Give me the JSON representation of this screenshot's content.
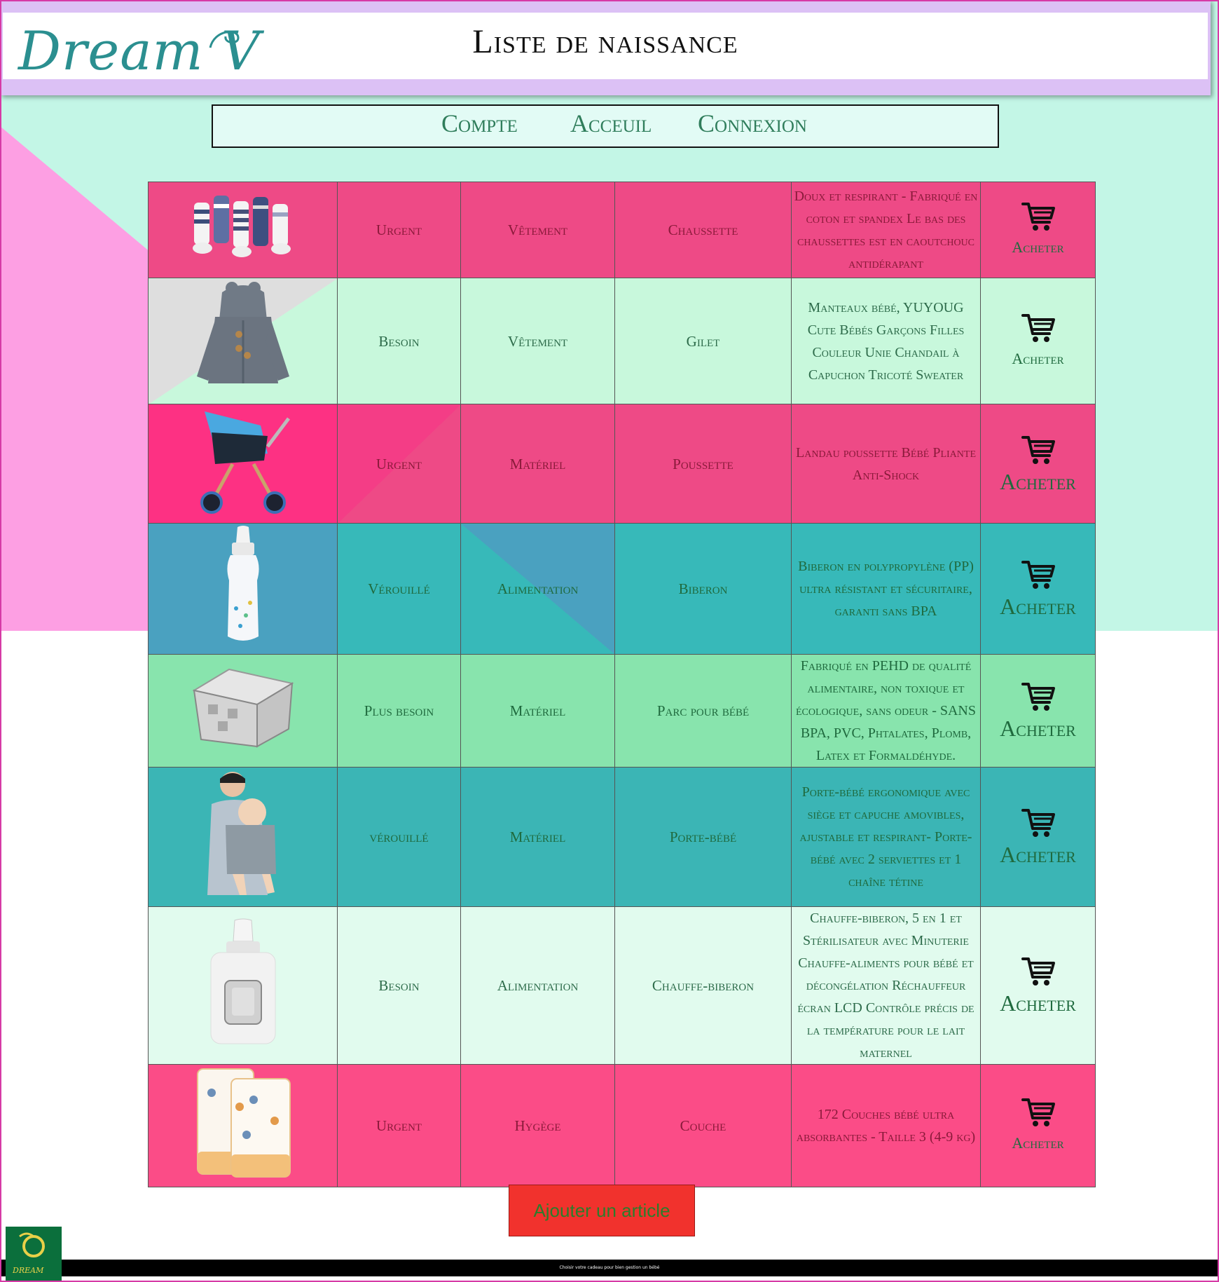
{
  "header": {
    "logo": "Dream V",
    "title": "Liste de naissance"
  },
  "nav": {
    "items": [
      "Compte",
      "Acceuil",
      "Connexion"
    ]
  },
  "rows": [
    {
      "status": "Urgent",
      "category": "Vêtement",
      "name": "Chaussette",
      "description": "Doux et respirant  - Fabriqué en coton et spandex Le bas des chaussettes est en caoutchouc antidérapant",
      "buy": "Acheter",
      "image": "socks"
    },
    {
      "status": "Besoin",
      "category": "Vêtement",
      "name": "Gilet",
      "description": "Manteaux bébé, YUYOUG Cute Bébés Garçons Filles Couleur Unie Chandail à Capuchon Tricoté Sweater",
      "buy": "Acheter",
      "image": "hooded-cardigan"
    },
    {
      "status": "Urgent",
      "category": "Matériel",
      "name": "Poussette",
      "description": "Landau poussette Bébé Pliante Anti-Shock",
      "buy": "Acheter",
      "image": "stroller"
    },
    {
      "status": "Vérouillé",
      "category": "Alimentation",
      "name": "Biberon",
      "description": "Biberon en polypropylène (PP) ultra résistant et sécuritaire, garanti sans BPA",
      "buy": "Acheter",
      "image": "baby-bottle"
    },
    {
      "status": "Plus besoin",
      "category": "Matériel",
      "name": "Parc pour bébé",
      "description": "Fabriqué en PEHD de qualité alimentaire, non toxique et écologique, sans odeur - SANS BPA, PVC, Phtalates, Plomb, Latex et Formaldéhyde.",
      "buy": "Acheter",
      "image": "playpen"
    },
    {
      "status": "vérouillé",
      "category": "Matériel",
      "name": "Porte-bébé",
      "description": "Porte-bébé ergonomique avec siège et capuche amovibles, ajustable et respirant- Porte-bébé avec 2 serviettes et 1 chaîne tétine",
      "buy": "Acheter",
      "image": "baby-carrier"
    },
    {
      "status": "Besoin",
      "category": "Alimentation",
      "name": "Chauffe-biberon",
      "description": "Chauffe-biberon, 5 en 1 et Stérilisateur avec Minuterie Chauffe-aliments pour bébé et décongélation Réchauffeur écran LCD Contrôle précis de la température pour le lait maternel",
      "buy": "Acheter",
      "image": "bottle-warmer"
    },
    {
      "status": "Urgent",
      "category": "Hygège",
      "name": "Couche",
      "description": "172 Couches bébé ultra absorbantes - Taille 3 (4-9 kg)",
      "buy": "Acheter",
      "image": "diapers"
    }
  ],
  "actions": {
    "add_item": "Ajouter un article"
  },
  "footer": {
    "text": "Choisir votre cadeau pour bien gestion un bébé",
    "logo_text": "DREAM"
  },
  "colors": {
    "mint": "#c3f6e6",
    "pink": "#fd9fe3",
    "lavender": "#dcc1f5",
    "rose": "#ee4a86",
    "teal": "#37b9b9",
    "button_red": "#f1322d"
  }
}
